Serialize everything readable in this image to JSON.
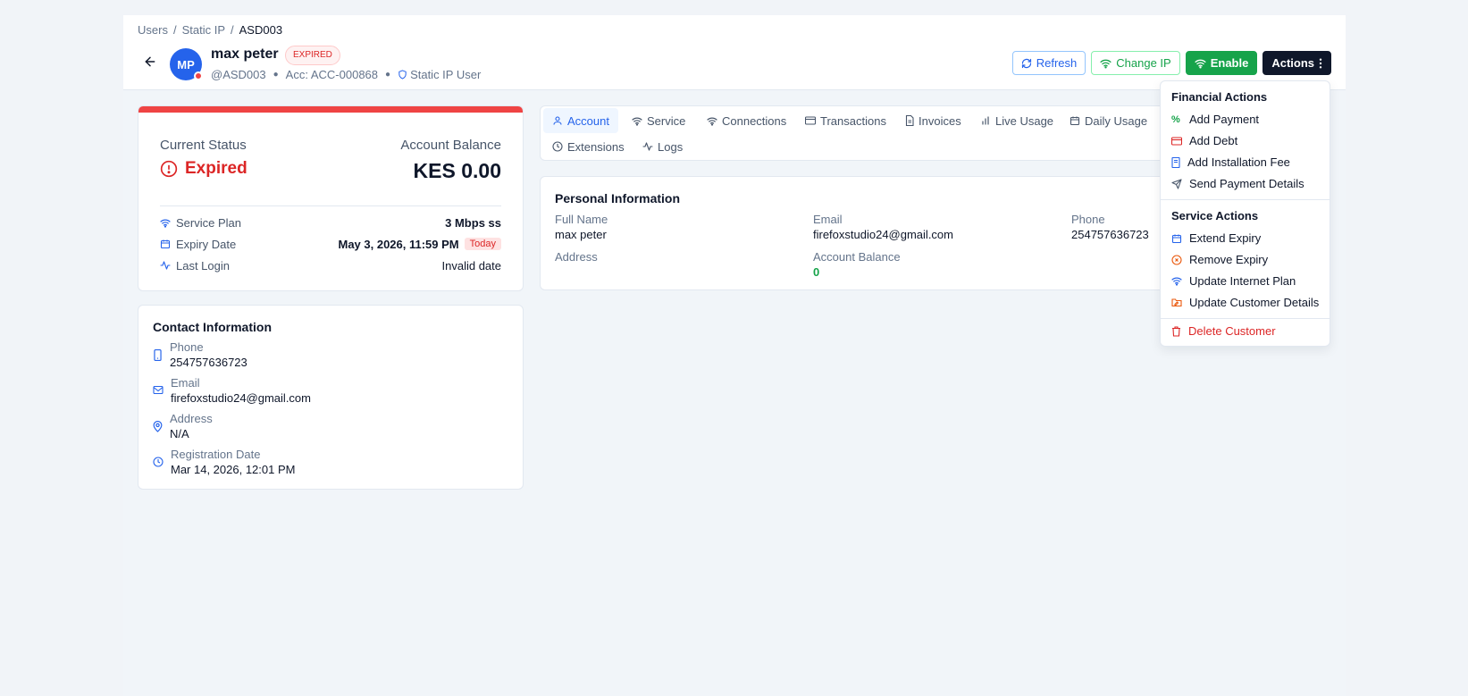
{
  "breadcrumb": {
    "items": [
      "Users",
      "Static IP"
    ],
    "current": "ASD003",
    "sep": "/"
  },
  "user": {
    "initials": "MP",
    "name": "max peter",
    "status_badge": "EXPIRED",
    "handle": "@ASD003",
    "account": "Acc: ACC-000868",
    "type": "Static IP User"
  },
  "toolbar": {
    "refresh": "Refresh",
    "change_ip": "Change IP",
    "enable": "Enable",
    "actions": "Actions"
  },
  "status": {
    "current_status_label": "Current Status",
    "current_status": "Expired",
    "balance_label": "Account Balance",
    "balance": "KES 0.00",
    "service_plan_label": "Service Plan",
    "service_plan": "3 Mbps ss",
    "expiry_label": "Expiry Date",
    "expiry": "May 3, 2026, 11:59 PM",
    "expiry_badge": "Today",
    "last_login_label": "Last Login",
    "last_login": "Invalid date"
  },
  "contact": {
    "title": "Contact Information",
    "phone_label": "Phone",
    "phone": "254757636723",
    "email_label": "Email",
    "email": "firefoxstudio24@gmail.com",
    "address_label": "Address",
    "address": "N/A",
    "reg_label": "Registration Date",
    "reg": "Mar 14, 2026, 12:01 PM"
  },
  "tabs": [
    "Account",
    "Service",
    "Connections",
    "Transactions",
    "Invoices",
    "Live Usage",
    "Daily Usage",
    "Extensions",
    "Logs"
  ],
  "personal": {
    "title": "Personal Information",
    "full_name_label": "Full Name",
    "full_name": "max peter",
    "email_label": "Email",
    "email": "firefoxstudio24@gmail.com",
    "phone_label": "Phone",
    "phone": "254757636723",
    "address_label": "Address",
    "balance_label": "Account Balance",
    "balance": "0"
  },
  "menu": {
    "financial_header": "Financial Actions",
    "add_payment": "Add Payment",
    "add_debt": "Add Debt",
    "add_installation_fee": "Add Installation Fee",
    "send_payment_details": "Send Payment Details",
    "service_header": "Service Actions",
    "extend_expiry": "Extend Expiry",
    "remove_expiry": "Remove Expiry",
    "update_plan": "Update Internet Plan",
    "update_customer": "Update Customer Details",
    "delete_customer": "Delete Customer"
  },
  "colors": {
    "primary": "#2563eb",
    "success": "#16a34a",
    "danger": "#dc2626",
    "dark": "#0f172a"
  }
}
